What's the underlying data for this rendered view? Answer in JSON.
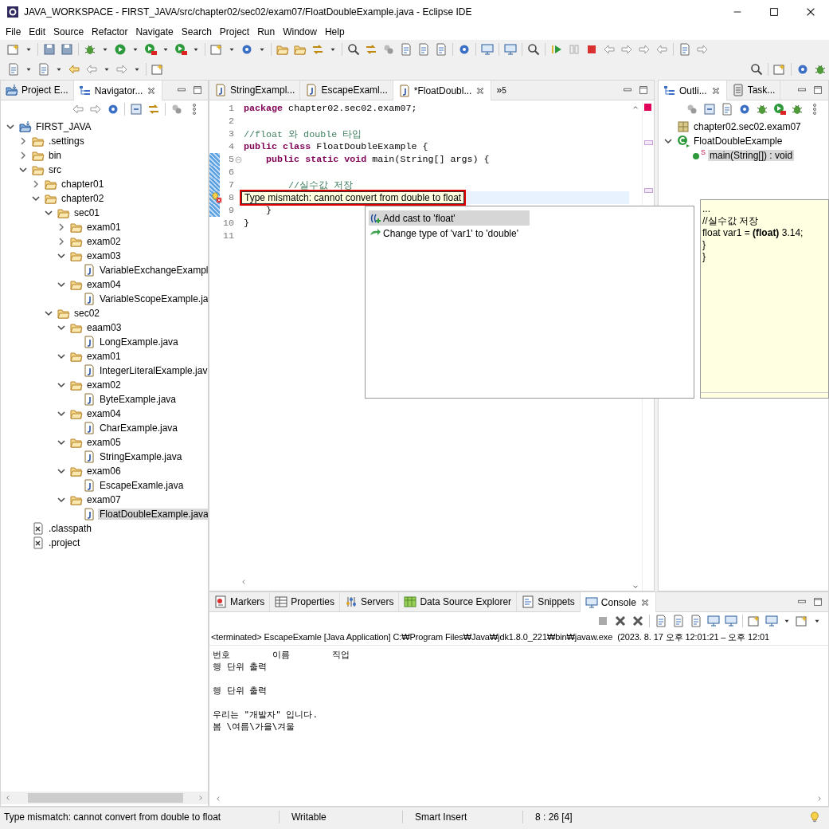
{
  "window": {
    "title": "JAVA_WORKSPACE - FIRST_JAVA/src/chapter02/sec02/exam07/FloatDoubleExample.java - Eclipse IDE"
  },
  "menu": [
    "File",
    "Edit",
    "Source",
    "Refactor",
    "Navigate",
    "Search",
    "Project",
    "Run",
    "Window",
    "Help"
  ],
  "left_panel": {
    "tabs": [
      {
        "label": "Project E...",
        "selected": false
      },
      {
        "label": "Navigator...",
        "selected": true
      }
    ],
    "tree": [
      {
        "label": "FIRST_JAVA",
        "kind": "project",
        "expanded": true,
        "selected": false,
        "children": [
          {
            "label": ".settings",
            "kind": "folder",
            "expanded": false,
            "selected": false
          },
          {
            "label": "bin",
            "kind": "folder",
            "expanded": false,
            "selected": false
          },
          {
            "label": "src",
            "kind": "folder",
            "expanded": true,
            "selected": false,
            "children": [
              {
                "label": "chapter01",
                "kind": "folder",
                "expanded": false,
                "selected": false
              },
              {
                "label": "chapter02",
                "kind": "folder",
                "expanded": true,
                "selected": false,
                "children": [
                  {
                    "label": "sec01",
                    "kind": "folder",
                    "expanded": true,
                    "selected": false,
                    "children": [
                      {
                        "label": "exam01",
                        "kind": "folder",
                        "expanded": false,
                        "selected": false
                      },
                      {
                        "label": "exam02",
                        "kind": "folder",
                        "expanded": false,
                        "selected": false
                      },
                      {
                        "label": "exam03",
                        "kind": "folder",
                        "expanded": true,
                        "selected": false,
                        "children": [
                          {
                            "label": "VariableExchangeExampl",
                            "kind": "java",
                            "selected": false
                          }
                        ]
                      },
                      {
                        "label": "exam04",
                        "kind": "folder",
                        "expanded": true,
                        "selected": false,
                        "children": [
                          {
                            "label": "VariableScopeExample.ja",
                            "kind": "java",
                            "selected": false
                          }
                        ]
                      }
                    ]
                  },
                  {
                    "label": "sec02",
                    "kind": "folder",
                    "expanded": true,
                    "selected": false,
                    "children": [
                      {
                        "label": "eaam03",
                        "kind": "folder",
                        "expanded": true,
                        "selected": false,
                        "children": [
                          {
                            "label": "LongExample.java",
                            "kind": "java",
                            "selected": false
                          }
                        ]
                      },
                      {
                        "label": "exam01",
                        "kind": "folder",
                        "expanded": true,
                        "selected": false,
                        "children": [
                          {
                            "label": "IntegerLiteralExample.jav",
                            "kind": "java",
                            "selected": false
                          }
                        ]
                      },
                      {
                        "label": "exam02",
                        "kind": "folder",
                        "expanded": true,
                        "selected": false,
                        "children": [
                          {
                            "label": "ByteExample.java",
                            "kind": "java",
                            "selected": false
                          }
                        ]
                      },
                      {
                        "label": "exam04",
                        "kind": "folder",
                        "expanded": true,
                        "selected": false,
                        "children": [
                          {
                            "label": "CharExample.java",
                            "kind": "java",
                            "selected": false
                          }
                        ]
                      },
                      {
                        "label": "exam05",
                        "kind": "folder",
                        "expanded": true,
                        "selected": false,
                        "children": [
                          {
                            "label": "StringExample.java",
                            "kind": "java",
                            "selected": false
                          }
                        ]
                      },
                      {
                        "label": "exam06",
                        "kind": "folder",
                        "expanded": true,
                        "selected": false,
                        "children": [
                          {
                            "label": "EscapeExamle.java",
                            "kind": "java",
                            "selected": false
                          }
                        ]
                      },
                      {
                        "label": "exam07",
                        "kind": "folder",
                        "expanded": true,
                        "selected": false,
                        "children": [
                          {
                            "label": "FloatDoubleExample.java",
                            "kind": "java",
                            "selected": true
                          }
                        ]
                      }
                    ]
                  }
                ]
              }
            ]
          },
          {
            "label": ".classpath",
            "kind": "xml",
            "selected": false
          },
          {
            "label": ".project",
            "kind": "xml",
            "selected": false
          }
        ]
      }
    ]
  },
  "editor": {
    "tabs": [
      {
        "label": "StringExampl...",
        "selected": false
      },
      {
        "label": "EscapeExaml...",
        "selected": false
      },
      {
        "label": "*FloatDoubl...",
        "selected": true
      }
    ],
    "overflow": {
      "label": "»",
      "count": "5"
    },
    "lines": [
      {
        "number": "1",
        "changed": false,
        "error": false,
        "current": false,
        "collapsible": false,
        "tokens": [
          {
            "kind": "keyword",
            "text": "package"
          },
          {
            "kind": "plain",
            "text": " chapter02.sec02.exam07;"
          }
        ]
      },
      {
        "number": "2",
        "changed": false,
        "error": false,
        "current": false,
        "collapsible": false
      },
      {
        "number": "3",
        "changed": false,
        "error": false,
        "current": false,
        "collapsible": false,
        "tokens": [
          {
            "kind": "comment",
            "text": "//float 와 double 타입"
          }
        ]
      },
      {
        "number": "4",
        "changed": false,
        "error": false,
        "current": false,
        "collapsible": false,
        "tokens": [
          {
            "kind": "keyword",
            "text": "public class"
          },
          {
            "kind": "plain",
            "text": " FloatDoubleExample {"
          }
        ]
      },
      {
        "number": "5",
        "changed": true,
        "error": false,
        "current": false,
        "collapsible": true,
        "tokens": [
          {
            "kind": "keyword",
            "text": "    public static void"
          },
          {
            "kind": "plain",
            "text": " main(String[] args) {"
          }
        ]
      },
      {
        "number": "6",
        "changed": true,
        "error": false,
        "current": false,
        "collapsible": false
      },
      {
        "number": "7",
        "changed": true,
        "error": false,
        "current": false,
        "collapsible": false,
        "tokens": [
          {
            "kind": "comment",
            "text": "        //실수값 저장"
          }
        ]
      },
      {
        "number": "8",
        "changed": true,
        "error": true,
        "current": true,
        "collapsible": false
      },
      {
        "number": "9",
        "changed": true,
        "error": false,
        "current": false,
        "collapsible": false,
        "tokens": [
          {
            "kind": "plain",
            "text": "    }"
          }
        ]
      },
      {
        "number": "10",
        "changed": false,
        "error": false,
        "current": false,
        "collapsible": false,
        "tokens": [
          {
            "kind": "plain",
            "text": "}"
          }
        ]
      },
      {
        "number": "11",
        "changed": false,
        "error": false,
        "current": false,
        "collapsible": false
      }
    ],
    "error_tooltip": "Type mismatch: cannot convert from double to float",
    "quick_fixes": [
      {
        "label": "Add cast to 'float'",
        "kind": "cast",
        "selected": true
      },
      {
        "label": "Change type of 'var1' to 'double'",
        "kind": "change",
        "selected": false
      }
    ],
    "preview": [
      "...",
      "//실수값 저장",
      "float var1 = **(float)** 3.14;",
      "}",
      "}"
    ]
  },
  "outline": {
    "tabs": [
      {
        "label": "Outli...",
        "selected": true
      },
      {
        "label": "Task...",
        "selected": false
      }
    ],
    "tree": [
      {
        "label": "chapter02.sec02.exam07",
        "kind": "package",
        "selected": false
      },
      {
        "label": "FloatDoubleExample",
        "kind": "class",
        "expanded": true,
        "selected": false,
        "children": [
          {
            "label": "main(String[]) : void",
            "kind": "method",
            "modifier": "S",
            "selected": true
          }
        ]
      }
    ]
  },
  "console": {
    "tabs": [
      {
        "label": "Markers",
        "selected": false
      },
      {
        "label": "Properties",
        "selected": false
      },
      {
        "label": "Servers",
        "selected": false
      },
      {
        "label": "Data Source Explorer",
        "selected": false
      },
      {
        "label": "Snippets",
        "selected": false
      },
      {
        "label": "Console",
        "selected": true
      }
    ],
    "header": "<terminated> EscapeExamle [Java Application] C:₩Program Files₩Java₩jdk1.8.0_221₩bin₩javaw.exe  (2023. 8. 17 오후 12:01:21 – 오후 12:01",
    "output": "번호        이름        직업\n행 단위 출력\n\n행 단위 출력\n\n우리는 \"개발자\" 입니다.\n봄 \\여름\\가을\\겨울"
  },
  "status_bar": [
    "Type mismatch: cannot convert from double to float",
    "Writable",
    "Smart Insert",
    "8 : 26 [4]"
  ]
}
